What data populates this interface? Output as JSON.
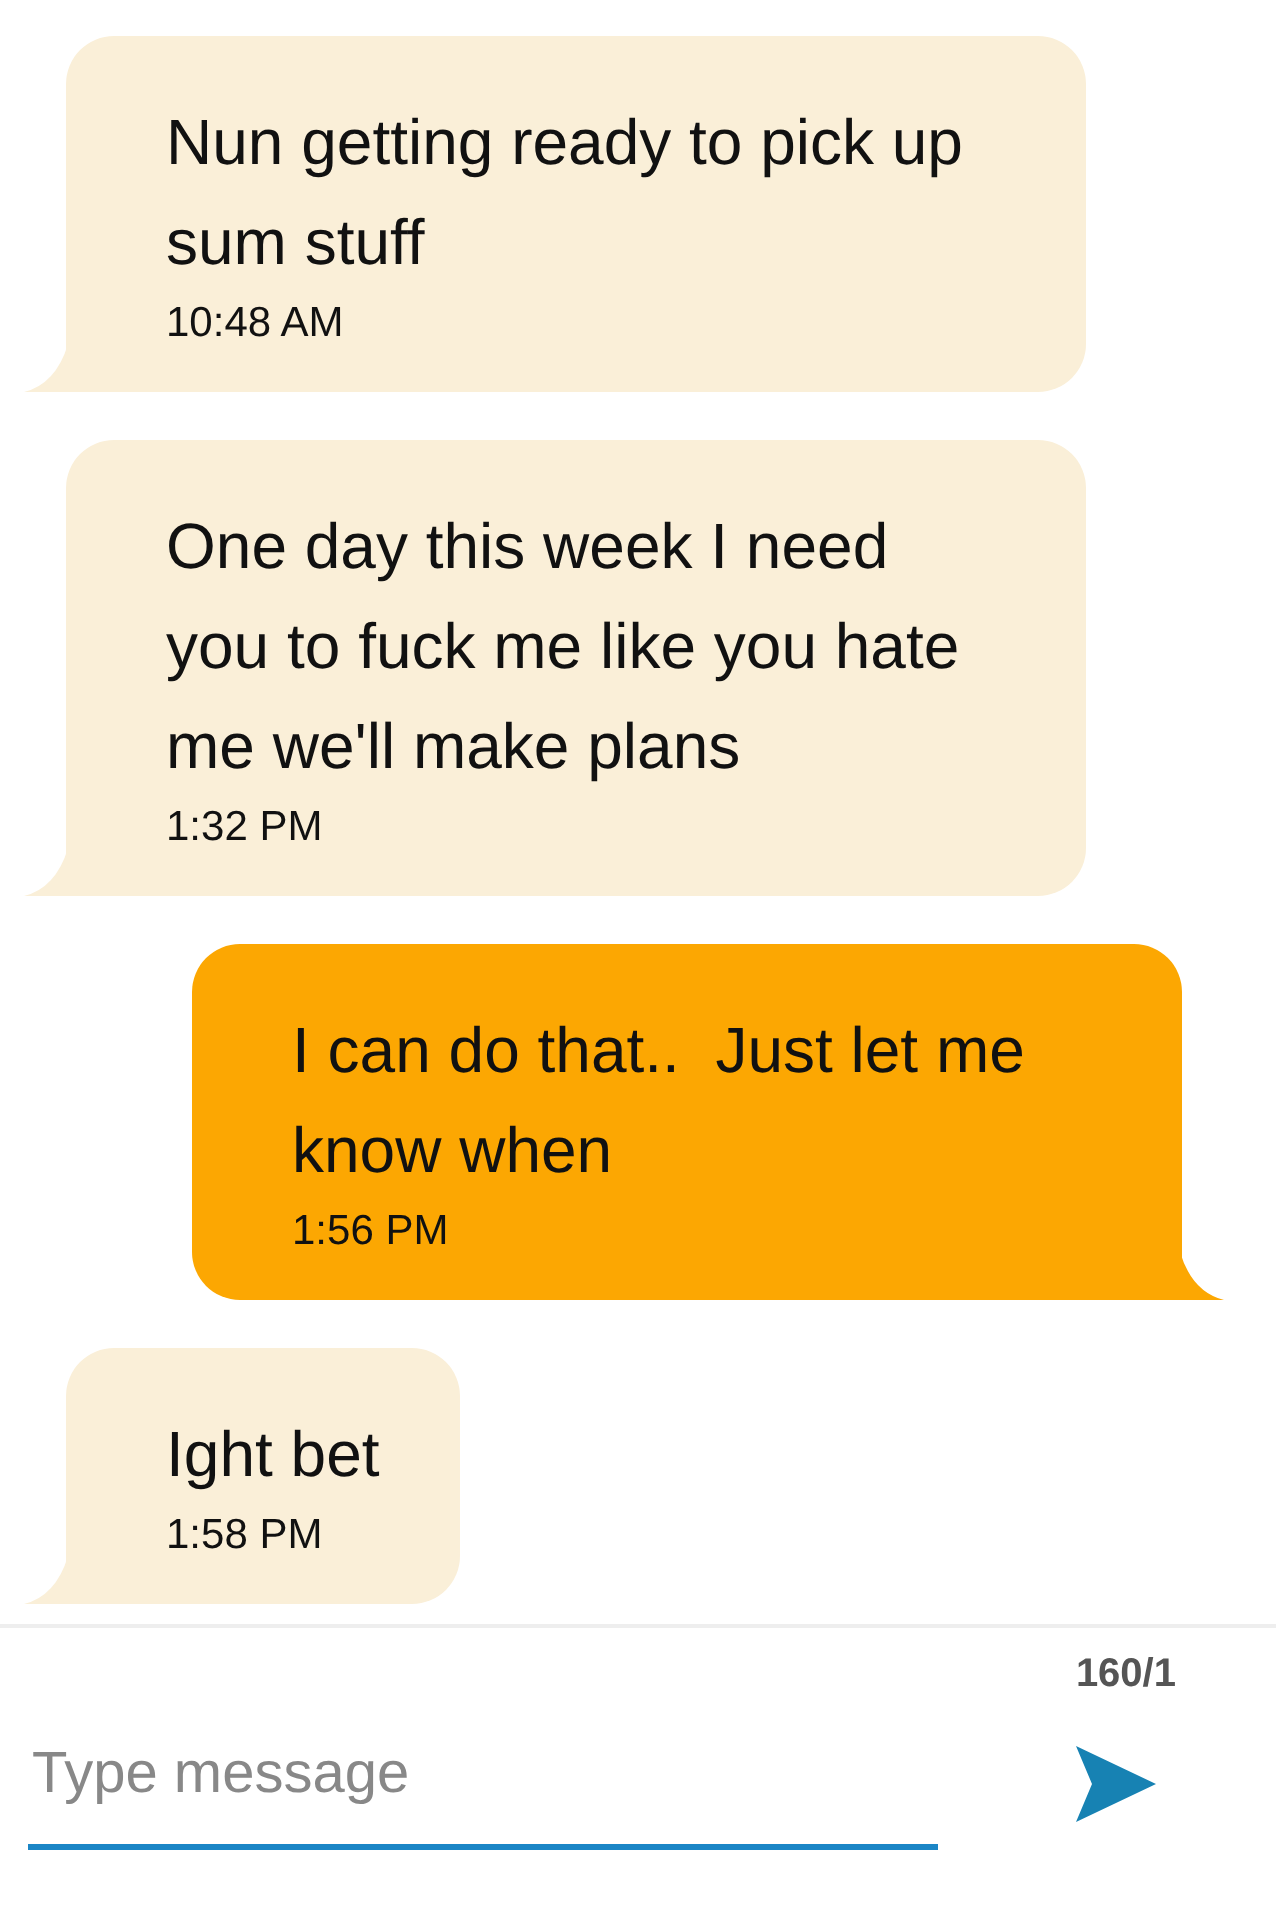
{
  "messages": [
    {
      "kind": "incoming",
      "text": "Nun getting ready to pick up sum stuff",
      "time": "10:48 AM"
    },
    {
      "kind": "incoming",
      "text": "One day this week I need you to fuck me like you hate me we'll make plans",
      "time": "1:32 PM"
    },
    {
      "kind": "outgoing",
      "text": "I can do that..  Just let me know when",
      "time": "1:56 PM"
    },
    {
      "kind": "incoming",
      "text": "Ight bet",
      "time": "1:58 PM"
    }
  ],
  "composer": {
    "counter": "160/1",
    "placeholder": "Type message"
  }
}
